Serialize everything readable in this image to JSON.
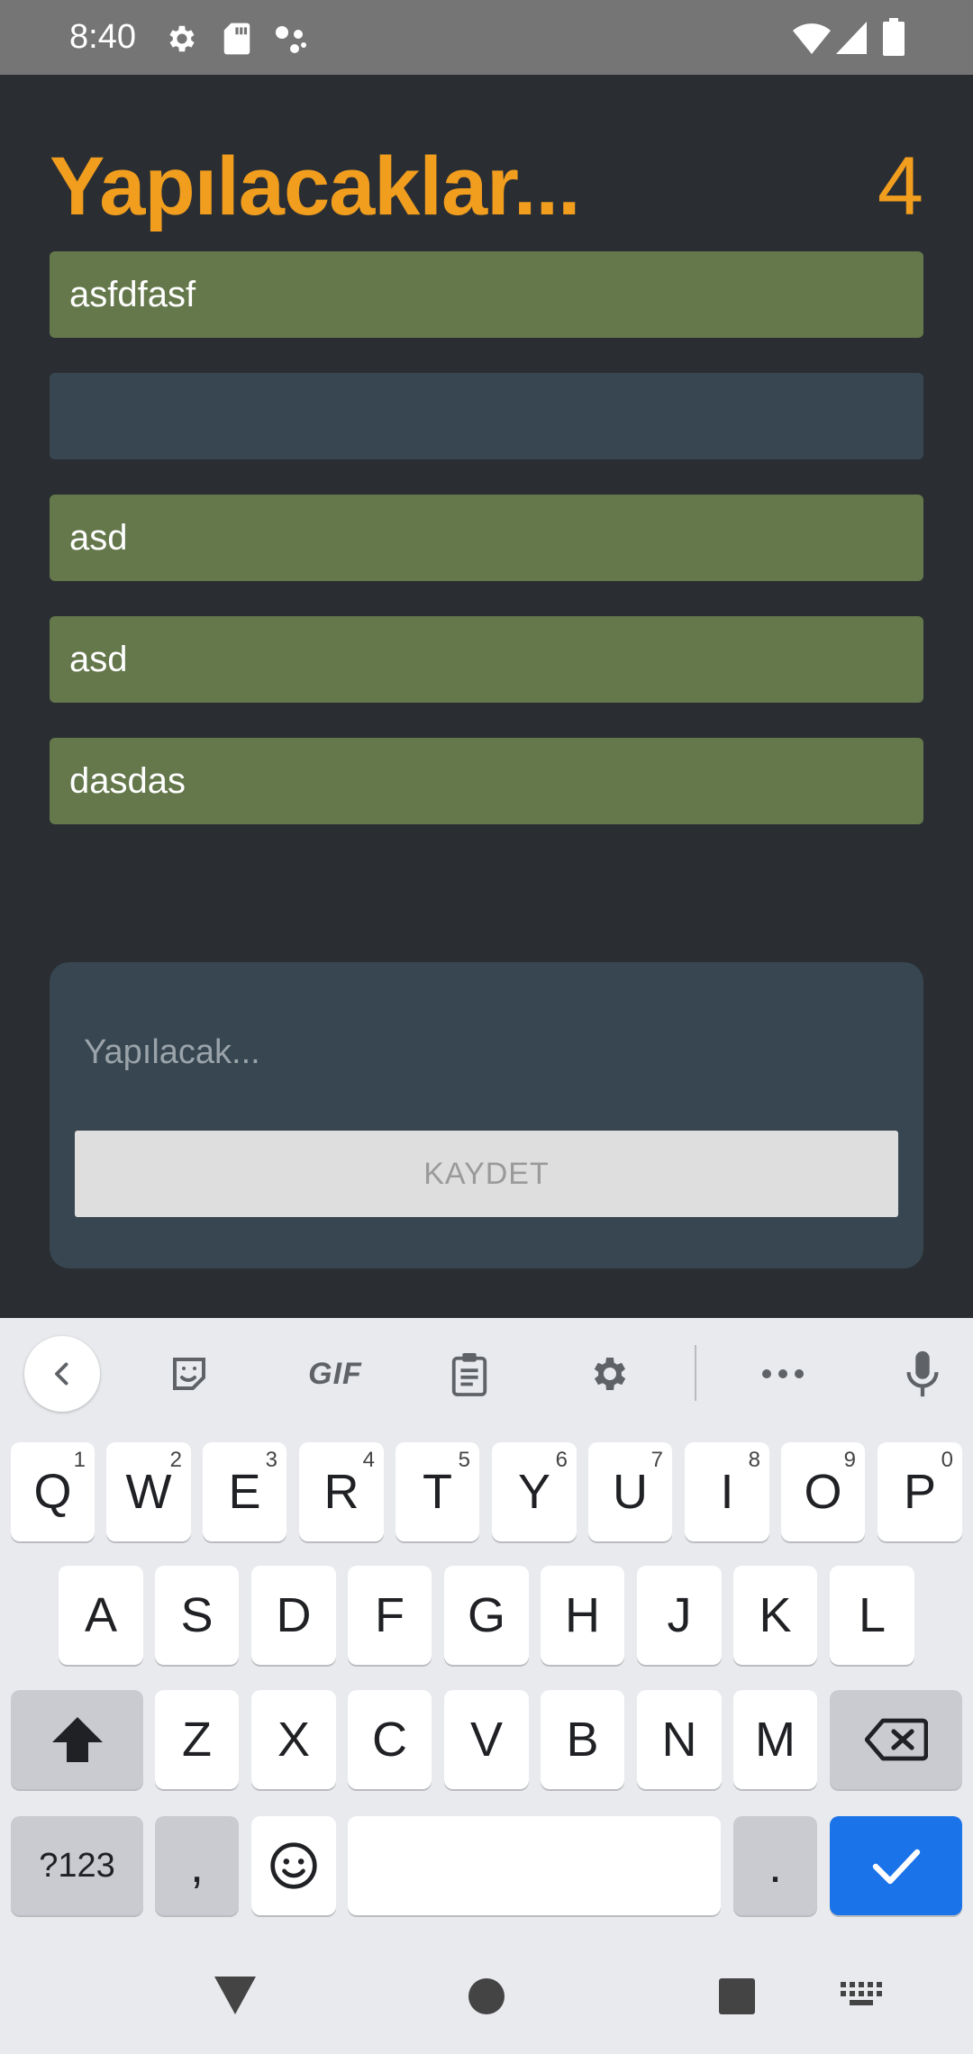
{
  "status_bar": {
    "time": "8:40",
    "icons": [
      "gear-icon",
      "sd-card-icon",
      "assistant-icon",
      "wifi-icon",
      "signal-icon",
      "battery-icon"
    ]
  },
  "app": {
    "title": "Yapılacaklar...",
    "count": "4",
    "colors": {
      "accent": "#f19d1e",
      "item_done": "#64784b",
      "item_empty": "#374650",
      "background": "#2a2e33"
    },
    "todos": [
      {
        "text": "asfdfasf"
      },
      {
        "text": ""
      },
      {
        "text": "asd"
      },
      {
        "text": "asd"
      },
      {
        "text": "dasdas"
      }
    ],
    "form": {
      "placeholder": "Yapılacak...",
      "value": "",
      "save_label": "KAYDET"
    }
  },
  "keyboard": {
    "toolbar": {
      "gif_label": "GIF",
      "icons": [
        "back-chevron-icon",
        "sticker-icon",
        "gif-icon",
        "clipboard-icon",
        "settings-icon",
        "more-icon",
        "mic-icon"
      ]
    },
    "row1": [
      {
        "label": "Q",
        "hint": "1"
      },
      {
        "label": "W",
        "hint": "2"
      },
      {
        "label": "E",
        "hint": "3"
      },
      {
        "label": "R",
        "hint": "4"
      },
      {
        "label": "T",
        "hint": "5"
      },
      {
        "label": "Y",
        "hint": "6"
      },
      {
        "label": "U",
        "hint": "7"
      },
      {
        "label": "I",
        "hint": "8"
      },
      {
        "label": "O",
        "hint": "9"
      },
      {
        "label": "P",
        "hint": "0"
      }
    ],
    "row2": [
      "A",
      "S",
      "D",
      "F",
      "G",
      "H",
      "J",
      "K",
      "L"
    ],
    "row3": [
      "Z",
      "X",
      "C",
      "V",
      "B",
      "N",
      "M"
    ],
    "row4": {
      "symbols_label": "?123",
      "comma_label": ",",
      "period_label": "."
    }
  },
  "nav_bar": {
    "icons": [
      "back-icon",
      "home-icon",
      "recents-icon",
      "keyboard-icon"
    ]
  }
}
